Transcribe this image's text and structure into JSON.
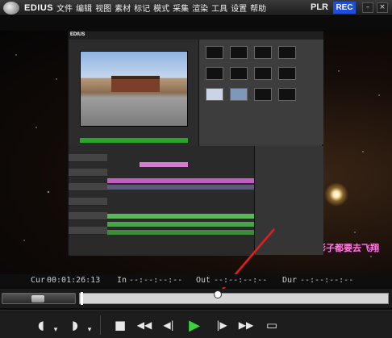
{
  "menubar": {
    "app_name": "EDIUS",
    "items": [
      "文件",
      "编辑",
      "视图",
      "素材",
      "标记",
      "模式",
      "采集",
      "渲染",
      "工具",
      "设置",
      "帮助"
    ],
    "plr_label": "PLR",
    "rec_label": "REC",
    "minimize": "–",
    "close": "×"
  },
  "preview": {
    "watermark": "影子都要去飞翔"
  },
  "timecodes": {
    "cur_label": "Cur",
    "cur_value": "00:01:26:13",
    "in_label": "In",
    "in_value": "--:--:--:--",
    "out_label": "Out",
    "out_value": "--:--:--:--",
    "dur_label": "Dur",
    "dur_value": "--:--:--:--"
  },
  "transport": {
    "set_in": "◖",
    "set_out": "◗",
    "stop": "■",
    "rewind": "◀◀",
    "step_back": "◀|",
    "play": "▶",
    "step_fwd": "|▶",
    "fast_fwd": "▶▶",
    "loop": "▭"
  },
  "colors": {
    "rec": "#1e4fd6",
    "play": "#3cd23c",
    "arrow": "#e21e1e",
    "watermark": "#ff7fd4"
  }
}
